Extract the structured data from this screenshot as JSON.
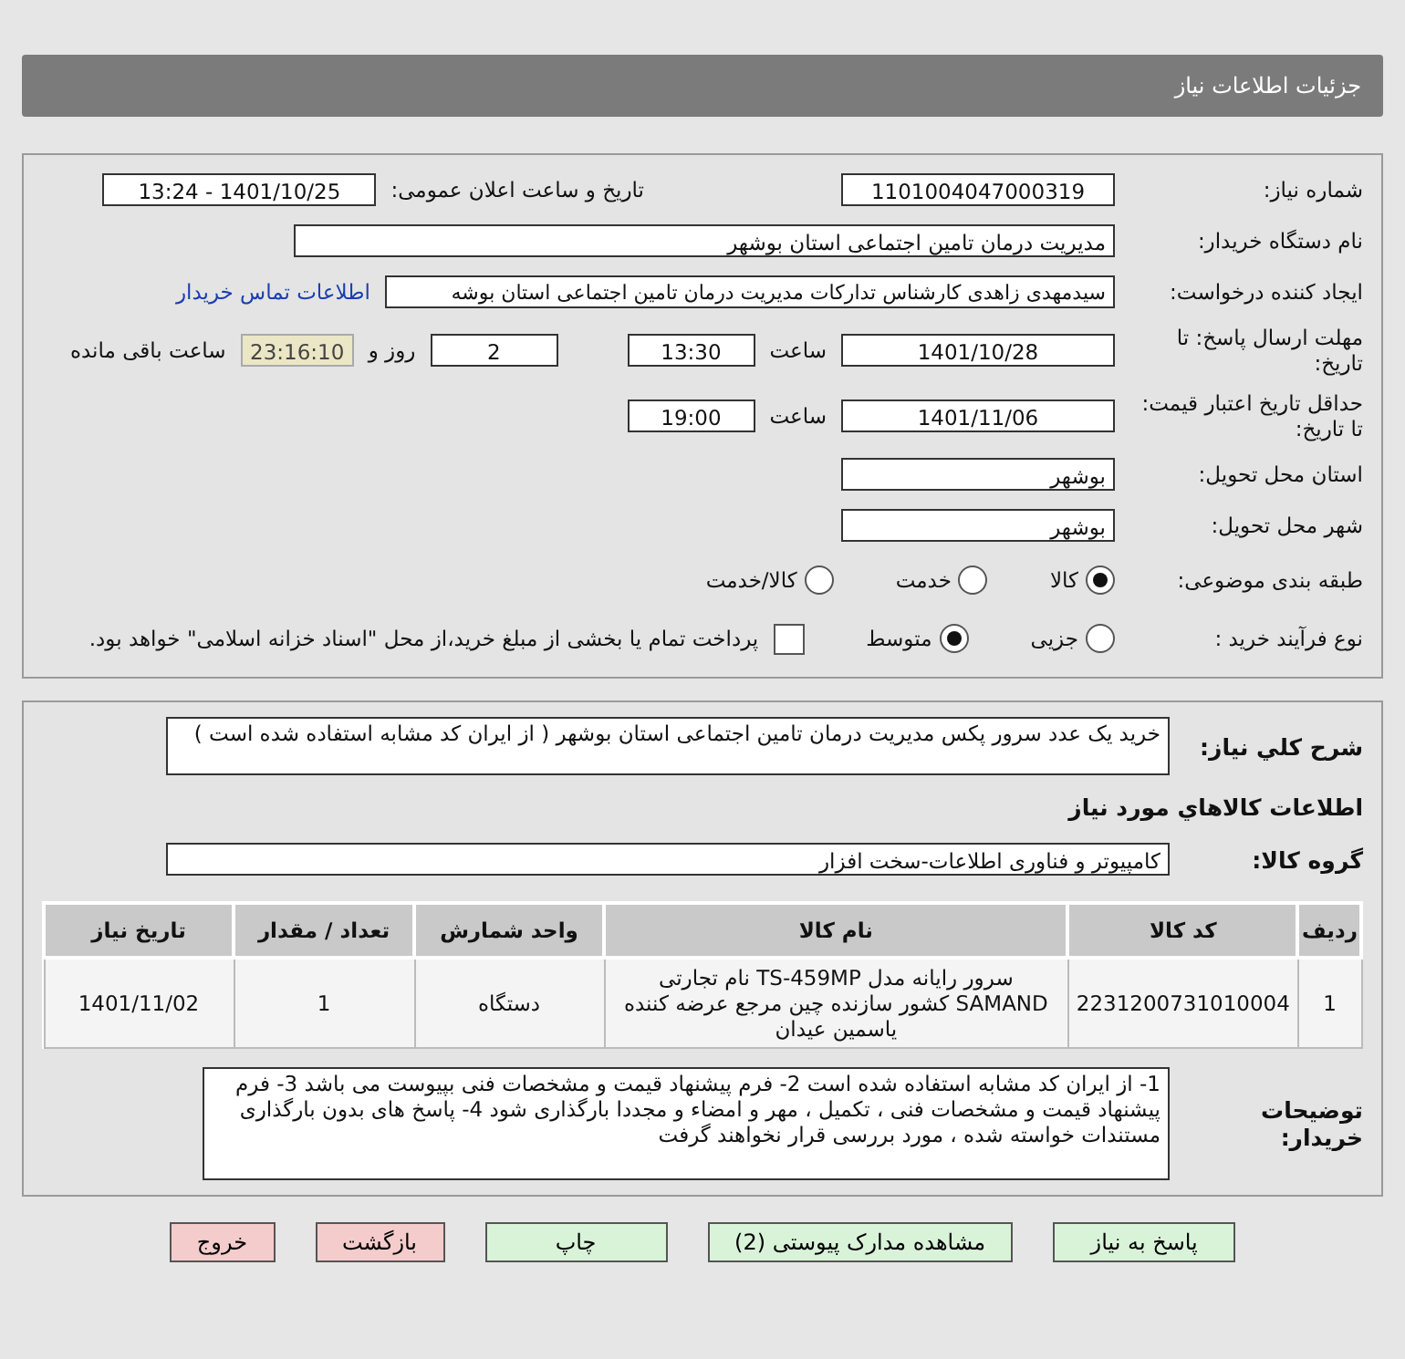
{
  "header": {
    "title": "جزئیات اطلاعات نیاز"
  },
  "need_number": {
    "label": "شماره نیاز:",
    "value": "1101004047000319"
  },
  "announce": {
    "label": "تاریخ و ساعت اعلان عمومی:",
    "value": "1401/10/25 - 13:24"
  },
  "buyer_org": {
    "label": "نام دستگاه خریدار:",
    "value": "مدیریت درمان تامین اجتماعی استان بوشهر"
  },
  "requester": {
    "label": "ایجاد کننده درخواست:",
    "value": "سیدمهدی زاهدی کارشناس تدارکات مدیریت درمان تامین اجتماعی استان بوشه",
    "link": "اطلاعات تماس خریدار"
  },
  "deadline": {
    "label": "مهلت ارسال پاسخ: تا تاریخ:",
    "date": "1401/10/28",
    "time_label": "ساعت",
    "time": "13:30",
    "days": "2",
    "days_label": "روز و",
    "remaining": "23:16:10",
    "remaining_label": "ساعت باقی مانده"
  },
  "validity": {
    "label": "حداقل تاریخ اعتبار قیمت: تا تاریخ:",
    "date": "1401/11/06",
    "time_label": "ساعت",
    "time": "19:00"
  },
  "province": {
    "label": "استان محل تحویل:",
    "value": "بوشهر"
  },
  "city": {
    "label": "شهر محل تحویل:",
    "value": "بوشهر"
  },
  "category": {
    "label": "طبقه بندی موضوعی:",
    "options": [
      {
        "label": "کالا",
        "selected": true
      },
      {
        "label": "خدمت",
        "selected": false
      },
      {
        "label": "کالا/خدمت",
        "selected": false
      }
    ]
  },
  "process": {
    "label": "نوع فرآیند خرید :",
    "options": [
      {
        "label": "جزیی",
        "selected": false
      },
      {
        "label": "متوسط",
        "selected": true
      }
    ],
    "payment": {
      "checked": false,
      "label": "پرداخت تمام یا بخشی از مبلغ خرید،از محل \"اسناد خزانه اسلامی\" خواهد بود."
    }
  },
  "summary": {
    "label": "شرح کلي نياز:",
    "value": "خرید یک عدد سرور پکس مدیریت درمان تامین اجتماعی استان بوشهر ( از ایران کد مشابه استفاده شده است )"
  },
  "goods_title": "اطلاعات کالاهاي مورد نياز",
  "goods_group": {
    "label": "گروه کالا:",
    "value": "کامپیوتر و فناوری اطلاعات-سخت افزار"
  },
  "table": {
    "columns": [
      "ردیف",
      "کد کالا",
      "نام کالا",
      "واحد شمارش",
      "تعداد / مقدار",
      "تاریخ نیاز"
    ],
    "rows": [
      [
        "1",
        "2231200731010004",
        "سرور رایانه مدل TS-459MP نام تجارتی SAMAND کشور سازنده چین مرجع عرضه کننده یاسمین عیدان",
        "دستگاه",
        "1",
        "1401/11/02"
      ]
    ]
  },
  "notes": {
    "label": "توضیحات خریدار:",
    "value": "1- از ایران کد مشابه استفاده شده است  2- فرم پیشنهاد قیمت و مشخصات فنی بپیوست می باشد 3- فرم پیشنهاد قیمت و مشخصات فنی ، تکمیل ، مهر و امضاء و مجددا بارگذاری شود  4- پاسخ های بدون بارگذاری مستندات خواسته شده ، مورد بررسی قرار نخواهند گرفت"
  },
  "buttons": [
    {
      "label": "پاسخ به نیاز",
      "kind": "action"
    },
    {
      "label": "مشاهده مدارک پیوستی (2)",
      "kind": "action"
    },
    {
      "label": "چاپ",
      "kind": "action"
    },
    {
      "label": "بازگشت",
      "kind": "exit"
    },
    {
      "label": "خروج",
      "kind": "exit"
    }
  ]
}
